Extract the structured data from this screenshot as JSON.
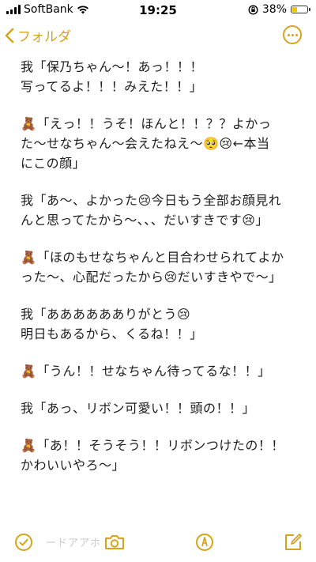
{
  "status_bar": {
    "carrier": "SoftBank",
    "time": "19:25",
    "battery": "38%",
    "battery_level": 0.38
  },
  "nav": {
    "back_label": "フォルダ",
    "back_icon": "chevron-left-icon",
    "more_icon": "ellipsis-circle-icon"
  },
  "note": {
    "paragraphs": [
      {
        "lines": [
          "我「保乃ちゃん〜！あっ！！！",
          "写ってるよ！！！みえた！！」"
        ]
      },
      {
        "lines": [
          "🧸「えっ！！うそ！ほんと！！？？よかっ",
          "た〜せなちゃん〜会えたねえ〜🥺😢←本当",
          "にこの顔」"
        ]
      },
      {
        "lines": [
          "我「あ〜、よかった😢今日もう全部お顔見れ",
          "んと思ってたから〜、、、だいすきです😢」"
        ]
      },
      {
        "lines": [
          "🧸「ほのもせなちゃんと目合わせられてよか",
          "った〜、心配だったから😢だいすきやで〜」"
        ]
      },
      {
        "lines": [
          "我「あああああありがとう😢",
          "明日もあるから、くるね！！」"
        ]
      },
      {
        "lines": [
          "🧸「うん！！せなちゃん待ってるな！！」"
        ]
      },
      {
        "lines": [
          "我「あっ、リボン可愛い！！頭の！！」"
        ]
      },
      {
        "lines": [
          "🧸「あ！！そうそう！！リボンつけたの！！",
          "かわいいやろ〜」"
        ]
      }
    ]
  },
  "toolbar": {
    "ghost_text": "ードアアホ",
    "accent_color": "#d6a31a",
    "icons": [
      "checklist-icon",
      "camera-icon",
      "markup-pen-icon",
      "compose-icon"
    ]
  }
}
